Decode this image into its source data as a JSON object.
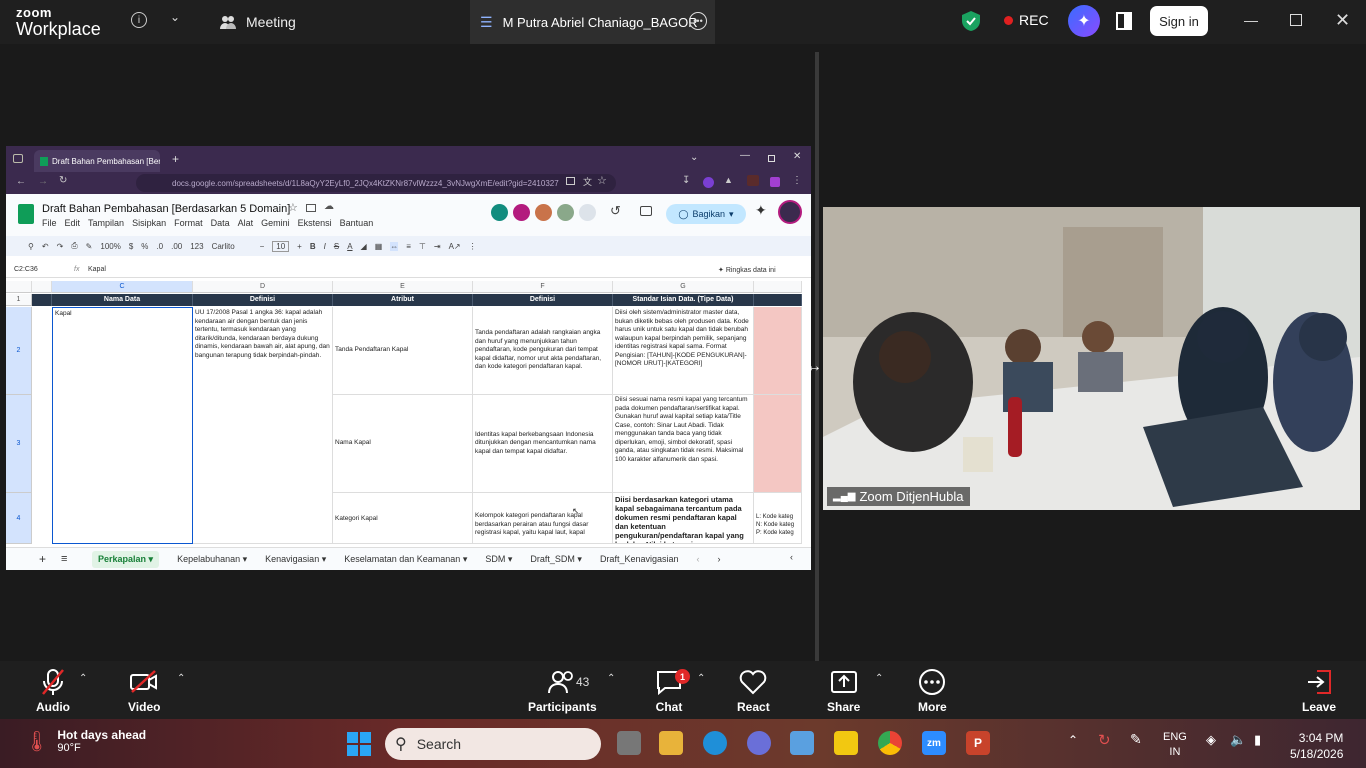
{
  "zoom": {
    "brand_top": "zoom",
    "brand_bottom": "Workplace",
    "meeting_label": "Meeting",
    "share_title": "M Putra Abriel Chaniago_BAGOR",
    "rec_label": "REC",
    "signin_label": "Sign in"
  },
  "browser": {
    "tab_title": "Draft Bahan Pembahasan [Berd",
    "url": "docs.google.com/spreadsheets/d/1L8aQyY2EyLf0_2JQx4KtZKNr87vlWzzz4_3vNJwgXmE/edit?gid=2410327"
  },
  "sheet": {
    "title": "Draft Bahan Pembahasan [Berdasarkan 5 Domain]",
    "menu": [
      "File",
      "Edit",
      "Tampilan",
      "Sisipkan",
      "Format",
      "Data",
      "Alat",
      "Gemini",
      "Ekstensi",
      "Bantuan"
    ],
    "share_label": "Bagikan",
    "zoom": "100%",
    "font": "Carlito",
    "font_size": "10",
    "cell_ref": "C2:C36",
    "formula_value": "Kapal",
    "summary_label": "Ringkas data ini",
    "col_letters": [
      "C",
      "D",
      "E",
      "F",
      "G"
    ],
    "row_numbers": [
      "1",
      "2",
      "3",
      "4"
    ],
    "headers": [
      "Nama Data",
      "Definisi",
      "Atribut",
      "Definisi",
      "Standar Isian Data. (Tipe Data)"
    ],
    "c2": "Kapal",
    "d2": "UU 17/2008 Pasal 1 angka 36: kapal adalah kendaraan air dengan bentuk dan jenis tertentu, termasuk kendaraan yang ditarik/ditunda, kendaraan berdaya dukung dinamis, kendaraan bawah air, alat apung, dan bangunan terapung tidak berpindah-pindah.",
    "e2": "Tanda Pendaftaran Kapal",
    "f2": "Tanda pendaftaran adalah rangkaian angka dan huruf yang menunjukkan tahun pendaftaran, kode pengukuran dari tempat kapal didaftar, nomor urut akta pendaftaran, dan kode kategori pendaftaran kapal.",
    "g2": "Diisi oleh sistem/administrator master data, bukan diketik bebas oleh produsen data. Kode harus unik untuk satu kapal dan tidak berubah walaupun kapal berpindah pemilik, sepanjang identitas registrasi kapal sama. Format Pengisian: [TAHUN]-[KODE PENGUKURAN]-[NOMOR URUT]-[KATEGORI]",
    "e3": "Nama Kapal",
    "f3": "Identitas kapal berkebangsaan Indonesia ditunjukkan dengan mencantumkan nama kapal dan tempat kapal didaftar.",
    "g3": "Diisi sesuai nama resmi kapal yang tercantum pada dokumen pendaftaran/sertifikat kapal. Gunakan huruf awal kapital setiap kata/Title Case, contoh: Sinar Laut Abadi. Tidak menggunakan tanda baca yang tidak diperlukan, emoji, simbol dekoratif, spasi ganda, atau singkatan tidak resmi. Maksimal 100 karakter alfanumerik dan spasi.",
    "e4": "Kategori Kapal",
    "f4": "Kelompok kategori pendaftaran kapal berdasarkan perairan atau fungsi dasar registrasi kapal, yaitu kapal laut, kapal",
    "g4": "Diisi berdasarkan kategori utama kapal sebagaimana tercantum pada dokumen resmi pendaftaran kapal dan ketentuan pengukuran/pendaftaran kapal yang berlaku. Nilai kategori",
    "h4": "L: Kode kateg N: Kode kateg P: Kode kateg",
    "tabs": [
      "Perkapalan",
      "Kepelabuhanan",
      "Kenavigasian",
      "Keselamatan dan Keamanan",
      "SDM",
      "Draft_SDM",
      "Draft_Kenavigasian"
    ]
  },
  "video": {
    "participant_name": "Zoom DitjenHubla"
  },
  "controls": {
    "audio": "Audio",
    "video": "Video",
    "participants": "Participants",
    "participants_count": "43",
    "chat": "Chat",
    "chat_badge": "1",
    "react": "React",
    "share": "Share",
    "more": "More",
    "leave": "Leave"
  },
  "taskbar": {
    "weather_title": "Hot days ahead",
    "weather_temp": "90°F",
    "search": "Search",
    "lang_top": "ENG",
    "lang_bottom": "IN",
    "time": "3:04 PM",
    "date": "5/18/2026"
  },
  "colors": {
    "sheet_header": "#28374a",
    "selected_col": "#d3e3fd",
    "pink_cell": "#f4c7c3",
    "leave": "#e02828",
    "shield": "#1aa260"
  }
}
